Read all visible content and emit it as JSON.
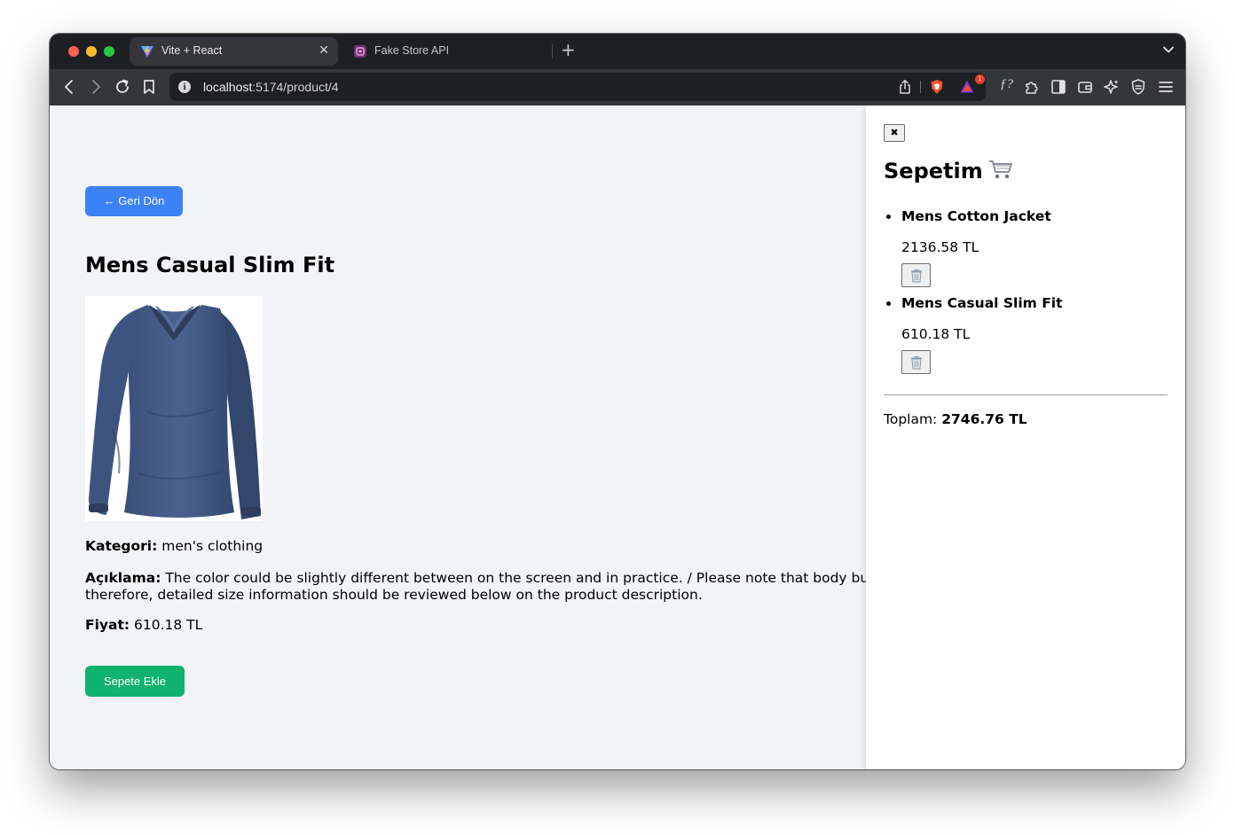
{
  "browser": {
    "tabs": [
      {
        "title": "Vite + React",
        "active": true
      },
      {
        "title": "Fake Store API",
        "active": false
      }
    ],
    "address": {
      "host": "localhost",
      "path": ":5174/product/4"
    },
    "notification_count": "1"
  },
  "page": {
    "back_button_label": "← Geri Dön",
    "product": {
      "title": "Mens Casual Slim Fit",
      "category_label": "Kategori:",
      "category": "men's clothing",
      "description_label": "Açıklama:",
      "description": "The color could be slightly different between on the screen and in practice. / Please note that body builds vary by person, therefore, detailed size information should be reviewed below on the product description.",
      "price_label": "Fiyat:",
      "price": "610.18 TL",
      "image_alt": "blue long-sleeve v-neck shirt"
    },
    "add_to_cart_label": "Sepete Ekle"
  },
  "cart": {
    "close_symbol": "✖",
    "title": "Sepetim",
    "items": [
      {
        "name": "Mens Cotton Jacket",
        "price": "2136.58 TL"
      },
      {
        "name": "Mens Casual Slim Fit",
        "price": "610.18 TL"
      }
    ],
    "total_label": "Toplam:",
    "total_value": "2746.76 TL"
  },
  "colors": {
    "back_button": "#3c82f6",
    "add_button": "#10b26f",
    "page_background": "#f1f3f6",
    "browser_chrome": "#1e1f23"
  }
}
